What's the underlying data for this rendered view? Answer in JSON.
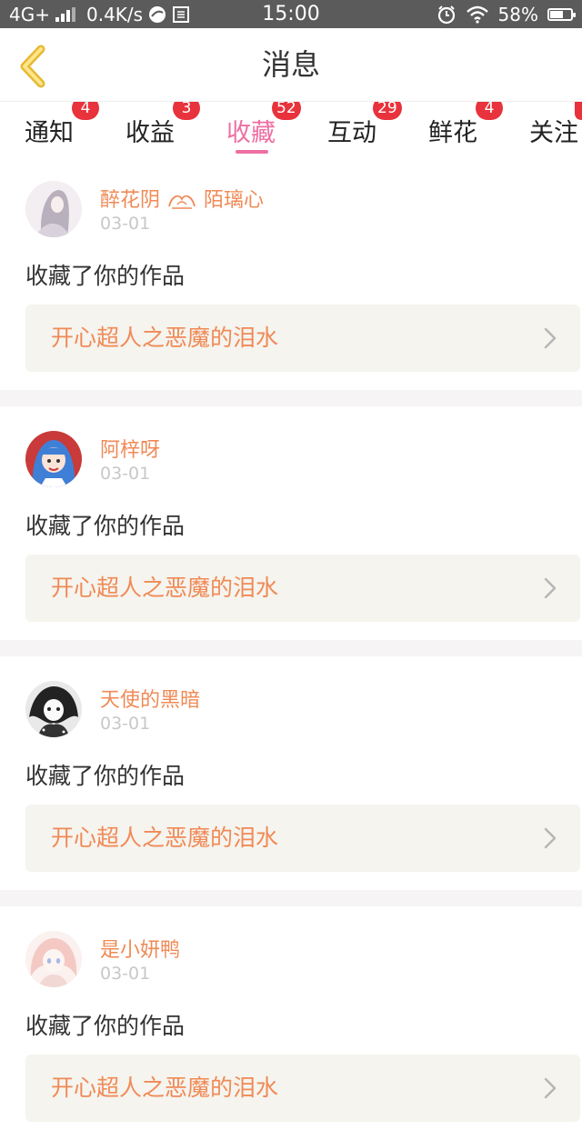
{
  "status_bar": {
    "network": "4G+",
    "speed": "0.4K/s",
    "time": "15:00",
    "battery": "58%"
  },
  "header": {
    "title": "消息"
  },
  "tabs": [
    {
      "label": "通知",
      "badge": "4",
      "active": false
    },
    {
      "label": "收益",
      "badge": "3",
      "active": false
    },
    {
      "label": "收藏",
      "badge": "52",
      "active": true
    },
    {
      "label": "互动",
      "badge": "29",
      "active": false
    },
    {
      "label": "鲜花",
      "badge": "4",
      "active": false
    },
    {
      "label": "关注",
      "badge": "",
      "active": false
    }
  ],
  "feed": [
    {
      "user": "醉花阴",
      "user_suffix": "陌璃心",
      "date": "03-01",
      "action": "收藏了你的作品",
      "work": "开心超人之恶魔的泪水"
    },
    {
      "user": "阿梓呀",
      "date": "03-01",
      "action": "收藏了你的作品",
      "work": "开心超人之恶魔的泪水"
    },
    {
      "user": "天使的黑暗",
      "date": "03-01",
      "action": "收藏了你的作品",
      "work": "开心超人之恶魔的泪水"
    },
    {
      "user": "是小妍鸭",
      "date": "03-01",
      "action": "收藏了你的作品",
      "work": "开心超人之恶魔的泪水"
    }
  ],
  "colors": {
    "accent_pink": "#ee6fa3",
    "name_orange": "#f08a56",
    "badge_red": "#e8323c",
    "back_yellow": "#f2c94c"
  },
  "icons": {
    "back": "chevron-left-icon",
    "row_arrow": "chevron-right-icon"
  }
}
